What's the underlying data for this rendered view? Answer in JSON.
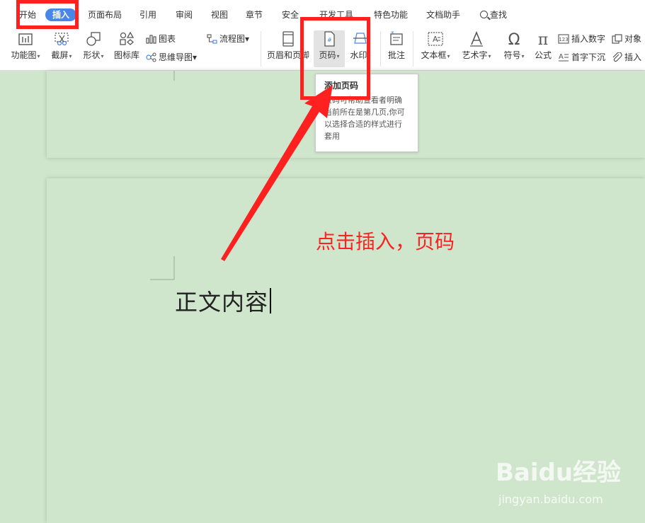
{
  "menu": {
    "tabs": [
      "开始",
      "插入",
      "页面布局",
      "引用",
      "审阅",
      "视图",
      "章节",
      "安全",
      "开发工具",
      "特色功能",
      "文档助手"
    ],
    "search_label": "查找"
  },
  "toolbar": {
    "func_chart": "功能图",
    "screenshot": "截屏",
    "shapes": "形状",
    "icon_lib": "图标库",
    "chart": "图表",
    "mindmap": "思维导图",
    "flowchart": "流程图",
    "header_footer": "页眉和页脚",
    "page_number": "页码",
    "watermark": "水印",
    "comment": "批注",
    "textbox": "文本框",
    "wordart": "艺术字",
    "symbol": "符号",
    "formula": "公式",
    "insert_number": "插入数字",
    "drop_cap": "首字下沉",
    "object": "对象",
    "insert_attach": "插入"
  },
  "tooltip": {
    "title": "添加页码",
    "body": "页码可帮助查看者明确当前所在是第几页,你可以选择合适的样式进行套用"
  },
  "document": {
    "body_text": "正文内容"
  },
  "annotation": {
    "text": "点击插入，页码",
    "color": "#ff2020"
  },
  "watermark": {
    "logo": "Baidu经验",
    "url": "jingyan.baidu.com"
  }
}
